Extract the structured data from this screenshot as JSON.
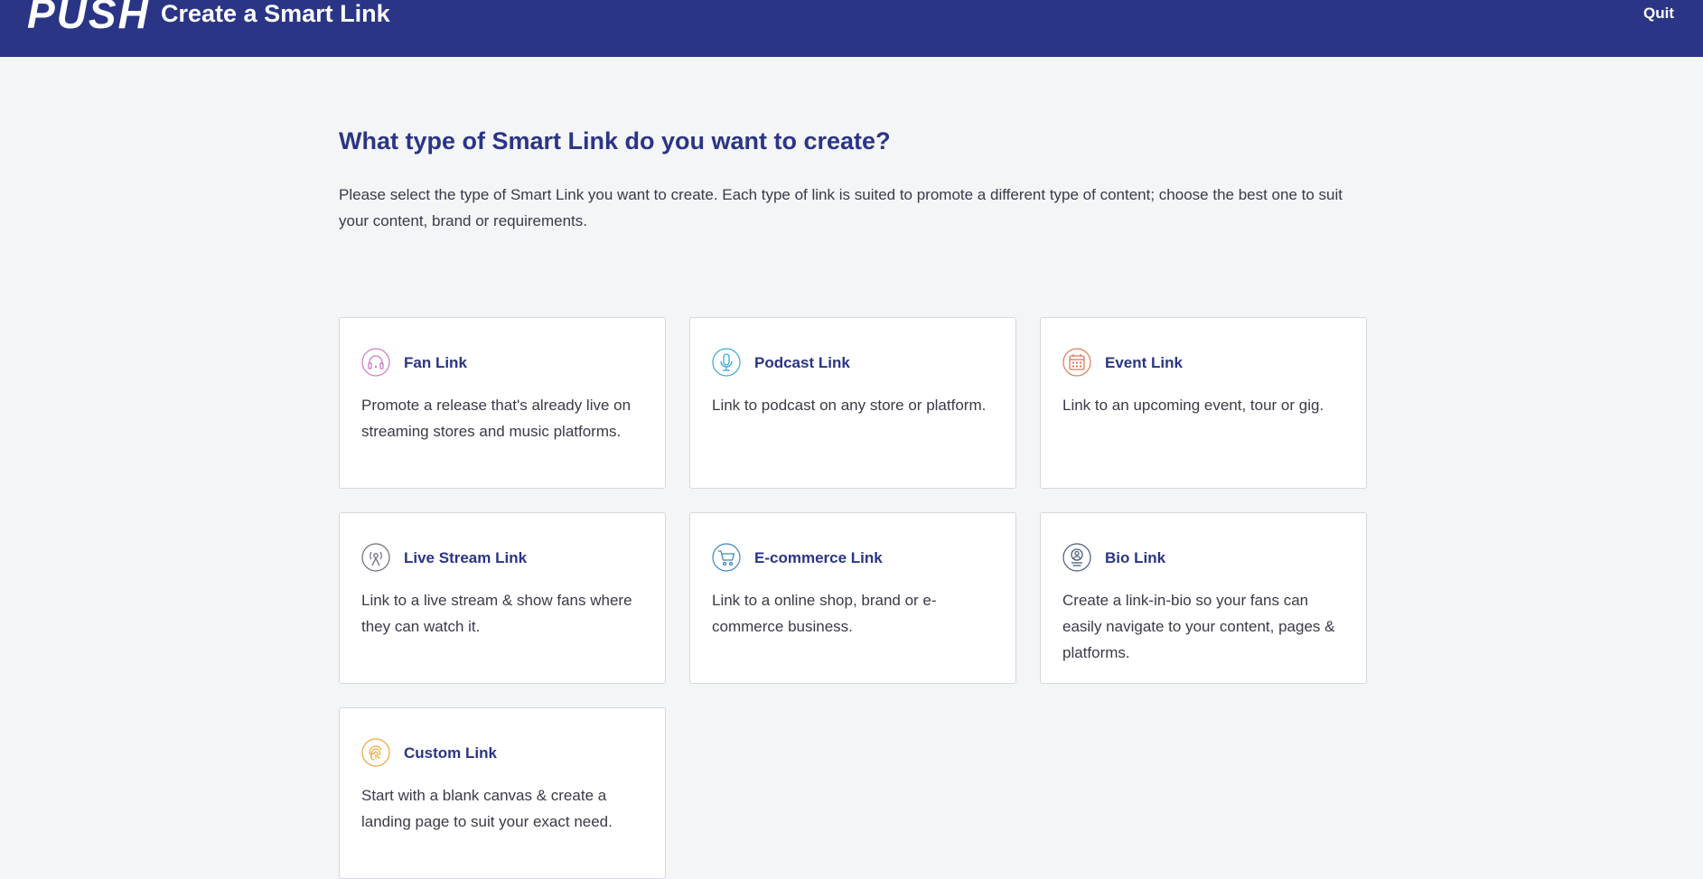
{
  "header": {
    "logo": "PUSH",
    "title": "Create a Smart Link",
    "quit_label": "Quit"
  },
  "main": {
    "heading": "What type of Smart Link do you want to create?",
    "intro": "Please select the type of Smart Link you want to create. Each type of link is suited to promote a different type of content; choose the best one to suit your content, brand or requirements."
  },
  "link_types": [
    {
      "title": "Fan Link",
      "description": "Promote a release that's already live on streaming stores and music platforms.",
      "icon": "headphones-icon",
      "color": "#c97bc4"
    },
    {
      "title": "Podcast Link",
      "description": "Link to podcast on any store or platform.",
      "icon": "microphone-icon",
      "color": "#3aa9d8"
    },
    {
      "title": "Event Link",
      "description": "Link to an upcoming event, tour or gig.",
      "icon": "calendar-icon",
      "color": "#e0795a"
    },
    {
      "title": "Live Stream Link",
      "description": "Link to a live stream & show fans where they can watch it.",
      "icon": "broadcast-icon",
      "color": "#6d6d80"
    },
    {
      "title": "E-commerce Link",
      "description": "Link to a online shop, brand or e-commerce business.",
      "icon": "shopping-cart-icon",
      "color": "#3a86c8"
    },
    {
      "title": "Bio Link",
      "description": "Create a link-in-bio so your fans can easily navigate to your content, pages & platforms.",
      "icon": "profile-icon",
      "color": "#4b5b7a"
    },
    {
      "title": "Custom Link",
      "description": "Start with a blank canvas & create a landing page to suit your exact need.",
      "icon": "fingerprint-icon",
      "color": "#e8a83a"
    }
  ]
}
